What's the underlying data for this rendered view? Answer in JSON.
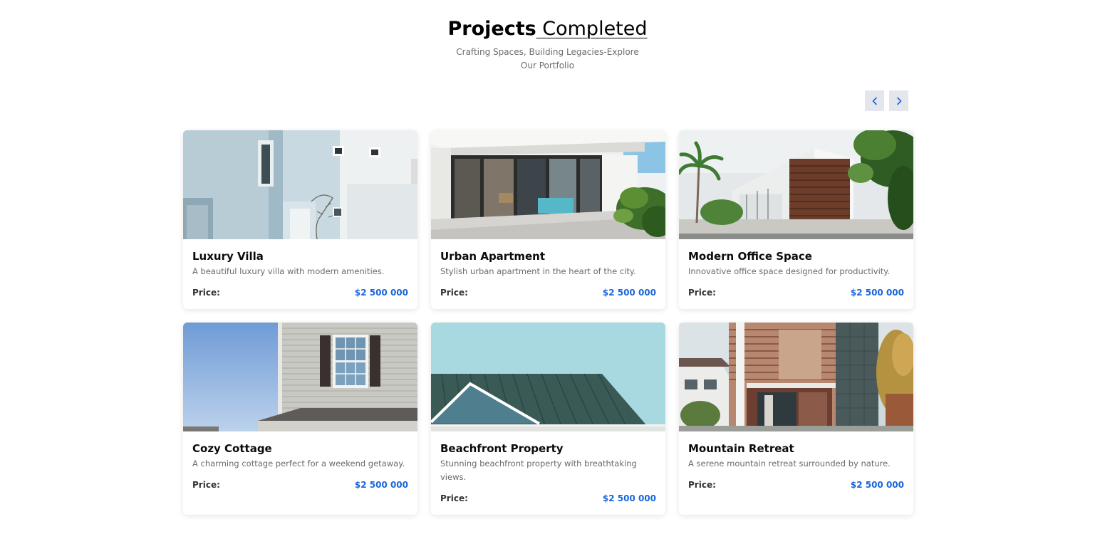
{
  "header": {
    "title_bold": "Projects",
    "title_rest": " Completed",
    "subtitle": "Crafting Spaces, Building Legacies-Explore Our Portfolio"
  },
  "nav": {
    "prev_icon": "chevron-left-icon",
    "next_icon": "chevron-right-icon",
    "accent": "#1a66d9"
  },
  "projects": [
    {
      "title": "Luxury Villa",
      "description": "A beautiful luxury villa with modern amenities.",
      "price_label": "Price:",
      "price": "$2 500 000",
      "image": "white-villa-photo"
    },
    {
      "title": "Urban Apartment",
      "description": "Stylish urban apartment in the heart of the city.",
      "price_label": "Price:",
      "price": "$2 500 000",
      "image": "glass-apartment-photo"
    },
    {
      "title": "Modern Office Space",
      "description": "Innovative office space designed for productivity.",
      "price_label": "Price:",
      "price": "$2 500 000",
      "image": "modern-office-photo"
    },
    {
      "title": "Cozy Cottage",
      "description": "A charming cottage perfect for a weekend getaway.",
      "price_label": "Price:",
      "price": "$2 500 000",
      "image": "cottage-siding-photo"
    },
    {
      "title": "Beachfront Property",
      "description": "Stunning beachfront property with breathtaking views.",
      "price_label": "Price:",
      "price": "$2 500 000",
      "image": "metal-roof-photo"
    },
    {
      "title": "Mountain Retreat",
      "description": "A serene mountain retreat surrounded by nature.",
      "price_label": "Price:",
      "price": "$2 500 000",
      "image": "wood-facade-photo"
    }
  ]
}
